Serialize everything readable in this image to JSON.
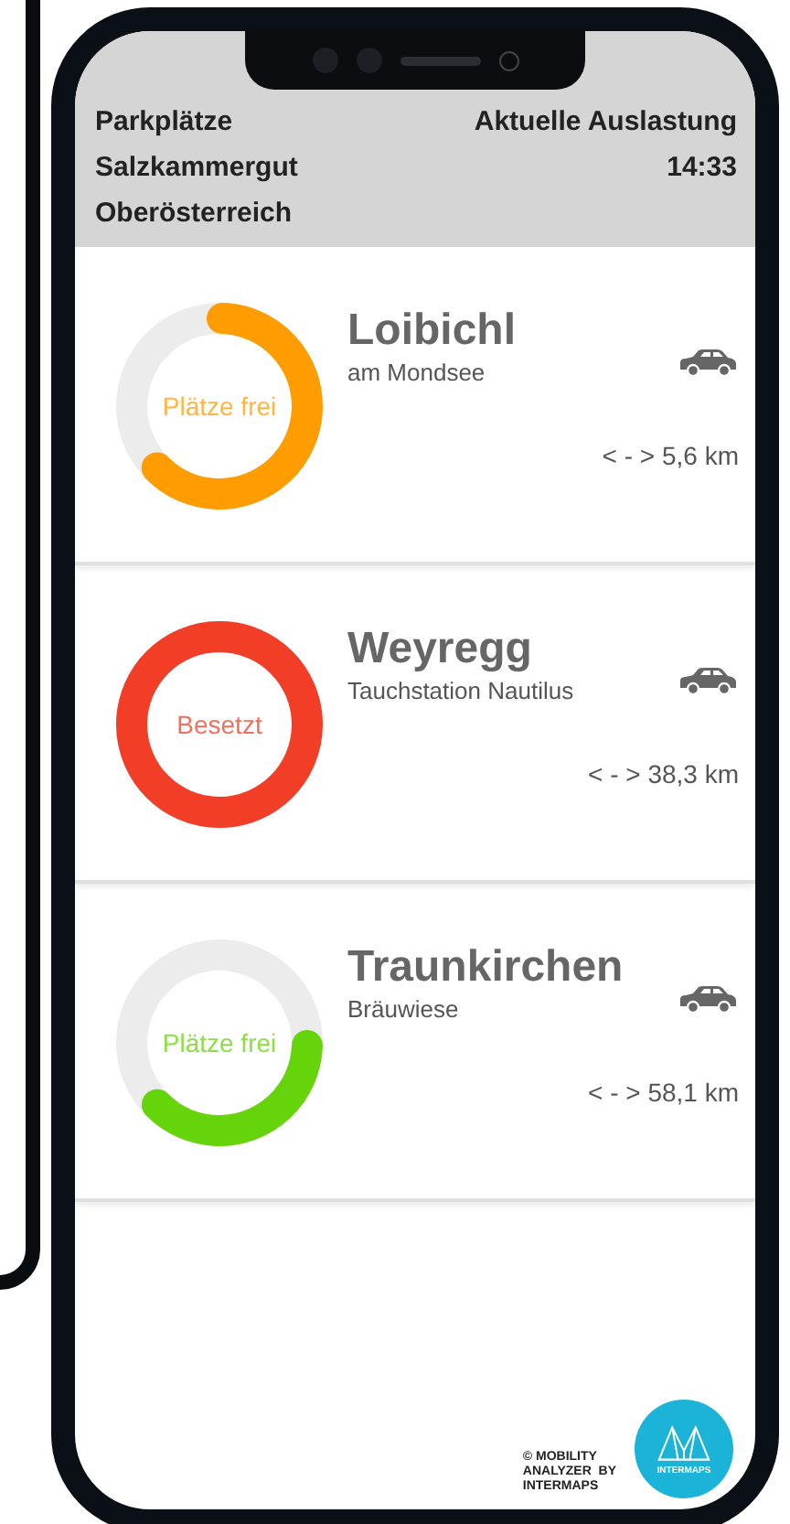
{
  "header": {
    "title_lines": [
      "Parkplätze",
      "Salzkammergut",
      "Oberösterreich"
    ],
    "status_label": "Aktuelle Auslastung",
    "time": "14:33"
  },
  "parkings": [
    {
      "name": "Loibichl",
      "subtitle": "am Mondsee",
      "status": "Plätze frei",
      "level": 0.62,
      "color": "#ff9d00",
      "distance": "< - > 5,6 km"
    },
    {
      "name": "Weyregg",
      "subtitle": "Tauchstation Nautilus",
      "status": "Besetzt",
      "level": 1,
      "color": "#f23d27",
      "distance": "< - > 38,3 km"
    },
    {
      "name": "Traunkirchen",
      "subtitle": "Bräuwiese",
      "status": "Plätze frei",
      "level": 0.37,
      "color": "#66d40a",
      "distance": "< - > 58,1 km"
    }
  ],
  "footer": {
    "credit_lines": [
      "© MOBILITY",
      "ANALYZER  BY",
      "INTERMAPS"
    ],
    "logo_text": "INTERMAPS"
  }
}
